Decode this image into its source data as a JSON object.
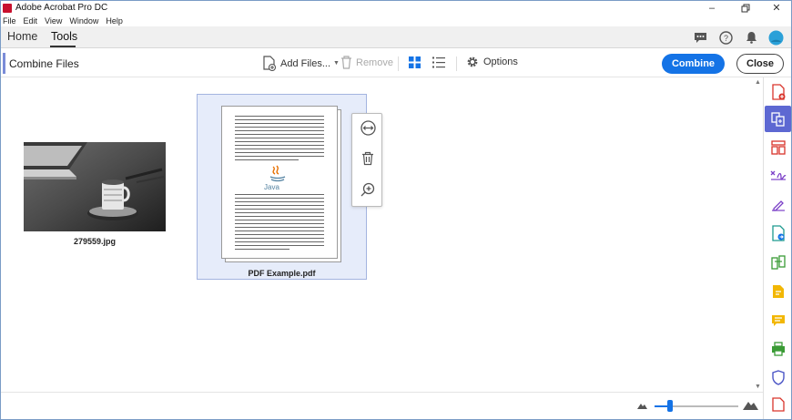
{
  "window": {
    "title": "Adobe Acrobat Pro DC"
  },
  "menu": [
    "File",
    "Edit",
    "View",
    "Window",
    "Help"
  ],
  "tabs": {
    "home": "Home",
    "tools": "Tools"
  },
  "toolbar": {
    "title": "Combine Files",
    "add_files": "Add Files...",
    "remove": "Remove",
    "options": "Options",
    "combine": "Combine",
    "close": "Close"
  },
  "files": [
    {
      "name": "279559.jpg",
      "type": "image"
    },
    {
      "name": "PDF Example.pdf",
      "type": "pdf",
      "selected": true
    }
  ],
  "pdf_preview": {
    "logo_text": "Java"
  },
  "zoom": {
    "level_fraction": 0.18
  },
  "colors": {
    "accent": "#1473e6",
    "rail_active": "#5d68d2",
    "selected_tile": "#e6ecfa"
  },
  "right_rail_icons": [
    "create-pdf-icon",
    "combine-files-icon",
    "organize-pages-icon",
    "edit-pdf-icon",
    "fill-sign-icon",
    "export-pdf-icon",
    "compare-files-icon",
    "send-for-comments-icon",
    "comment-icon",
    "print-production-icon",
    "protect-icon",
    "more-tools-icon"
  ]
}
